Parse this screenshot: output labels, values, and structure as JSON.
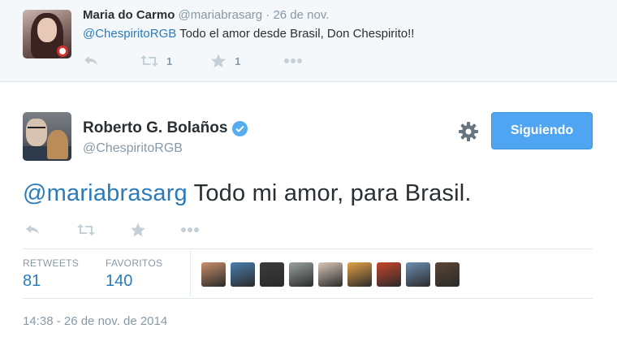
{
  "reply": {
    "name": "Maria do Carmo",
    "handle": "@mariabrasarg",
    "time": "· 26 de nov.",
    "mention": "@ChespiritoRGB",
    "text": " Todo el amor desde Brasil, Don Chespirito!!",
    "retweet_count": "1",
    "favorite_count": "1"
  },
  "tweet": {
    "name": "Roberto G. Bolaños",
    "handle": "@ChespiritoRGB",
    "follow_label": "Siguiendo",
    "mention": "@mariabrasarg",
    "text": " Todo mi amor, para Brasil.",
    "stats": {
      "retweets_label": "RETWEETS",
      "retweets_value": "81",
      "favorites_label": "FAVORITOS",
      "favorites_value": "140"
    },
    "timestamp": "14:38 - 26 de nov. de 2014"
  },
  "favoriters": [
    {
      "color": "#c98f6a"
    },
    {
      "color": "#4a7fb0"
    },
    {
      "color": "#3b3b3b"
    },
    {
      "color": "#9aa3a0"
    },
    {
      "color": "#d9c7b8"
    },
    {
      "color": "#e3a247"
    },
    {
      "color": "#c7452b"
    },
    {
      "color": "#6d8fb3"
    },
    {
      "color": "#5a4636"
    }
  ],
  "icons": {
    "reply": "reply-icon",
    "retweet": "retweet-icon",
    "favorite": "star-icon",
    "more": "more-icon",
    "verified": "verified-icon",
    "settings": "gear-icon"
  },
  "colors": {
    "accent": "#55acee",
    "link": "#2b7bb9",
    "follow_button": "#4fa5f1",
    "muted": "#8899a6"
  }
}
